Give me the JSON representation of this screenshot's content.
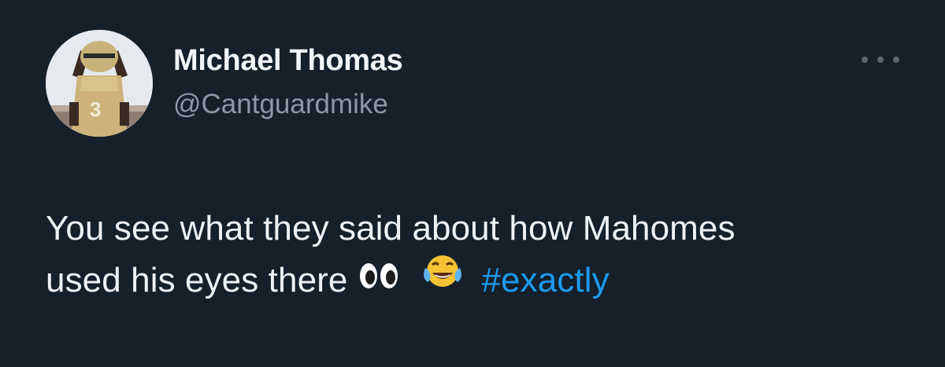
{
  "author": {
    "display_name": "Michael Thomas",
    "handle": "@Cantguardmike",
    "avatar_description": "profile-photo"
  },
  "more_menu": {
    "icon": "more-horizontal-icon"
  },
  "tweet": {
    "line1": "You see what they said about how Mahomes",
    "line2_text": "used his eyes there",
    "emojis": [
      "eyes-emoji",
      "face-with-tears-of-joy-emoji"
    ],
    "hashtag": "#exactly"
  },
  "colors": {
    "background": "#15202b",
    "primary_text": "#e7e9ea",
    "secondary_text": "#8b98a5",
    "link": "#1d9bf0"
  }
}
